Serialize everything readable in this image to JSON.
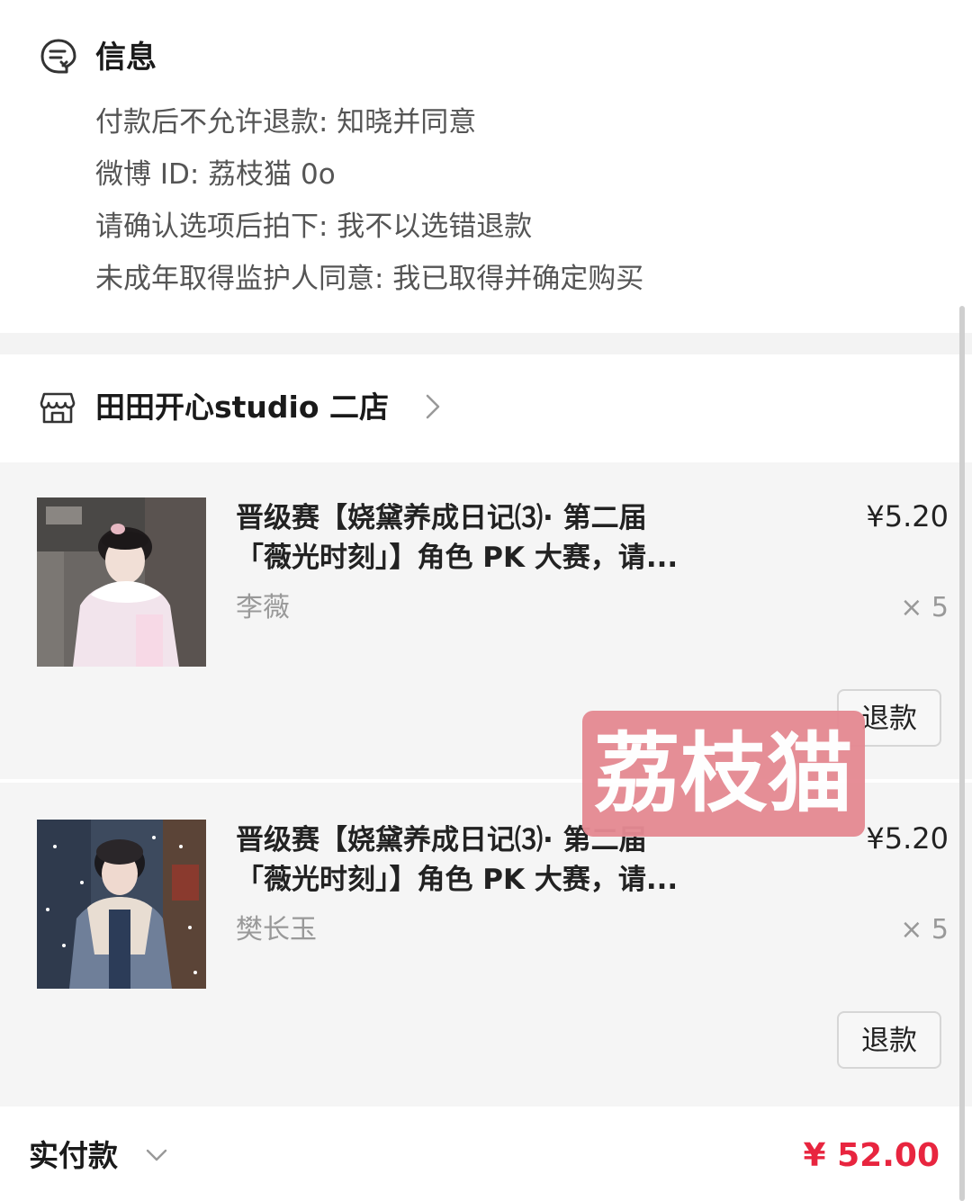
{
  "info": {
    "title": "信息",
    "icon": "message-list-icon",
    "lines": [
      "付款后不允许退款: 知晓并同意",
      "微博 ID: 荔枝猫 0o",
      "请确认选项后拍下: 我不以选错退款",
      "未成年取得监护人同意: 我已取得并确定购买"
    ]
  },
  "shop": {
    "icon": "store-icon",
    "name": "田田开心studio 二店"
  },
  "items": [
    {
      "title_line1": "晋级赛【娆黛养成日记⑶· 第二届",
      "title_line2": "「薇光时刻」】角色 PK 大赛，请...",
      "price": "¥5.20",
      "variant": "李薇",
      "qty": "× 5",
      "refund_label": "退款"
    },
    {
      "title_line1": "晋级赛【娆黛养成日记⑶· 第二届",
      "title_line2": "「薇光时刻」】角色 PK 大赛，请...",
      "price": "¥5.20",
      "variant": "樊长玉",
      "qty": "× 5",
      "refund_label": "退款"
    }
  ],
  "watermark": "荔枝猫",
  "footer": {
    "label": "实付款",
    "amount": "¥ 52.00"
  },
  "colors": {
    "accent_price": "#e8253f",
    "watermark_bg": "#e58a93"
  }
}
